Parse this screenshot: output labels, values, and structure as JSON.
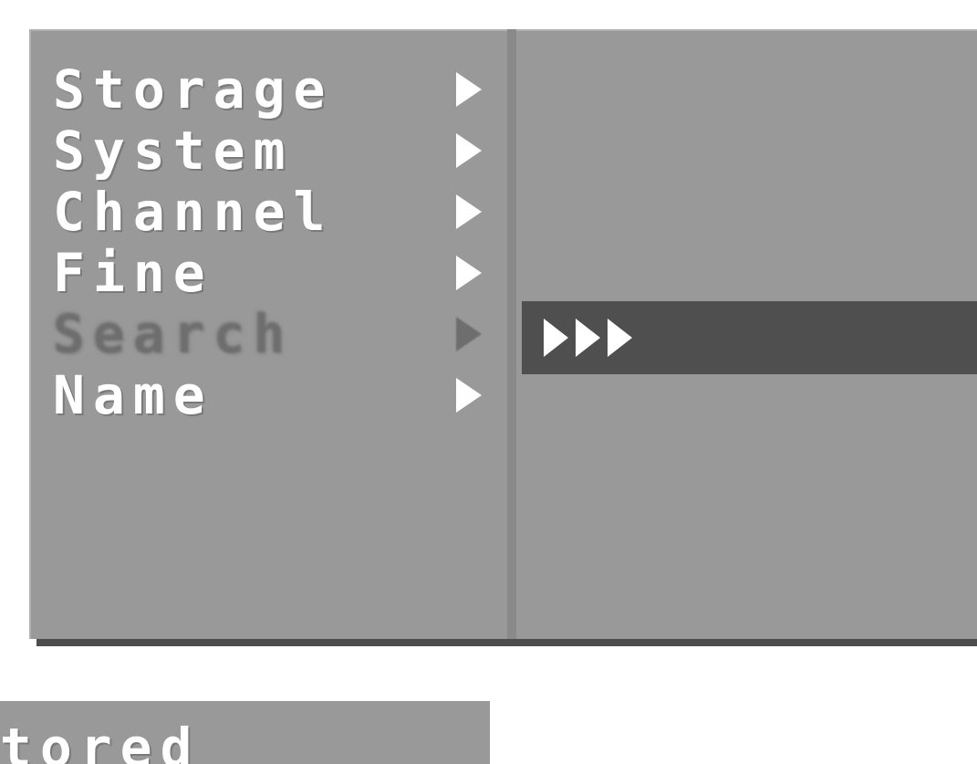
{
  "menu": {
    "items": [
      {
        "label": "Storage",
        "has_submenu": true,
        "disabled": false
      },
      {
        "label": "System",
        "has_submenu": true,
        "disabled": false
      },
      {
        "label": "Channel",
        "has_submenu": true,
        "disabled": false
      },
      {
        "label": "Fine",
        "has_submenu": true,
        "disabled": false
      },
      {
        "label": "Search",
        "has_submenu": true,
        "disabled": true
      },
      {
        "label": "Name",
        "has_submenu": true,
        "disabled": false
      }
    ],
    "submenu": {
      "highlighted_row_icons": [
        "play-arrow-icon",
        "play-arrow-icon",
        "play-arrow-icon"
      ]
    }
  },
  "status_bar": {
    "text": "Stored"
  },
  "colors": {
    "panel_bg": "#999999",
    "divider": "#8a8a8a",
    "highlight_bg": "#4f4f4f",
    "text": "#ffffff",
    "disabled_text": "#6e6e6e",
    "shadow": "#4d4d4d"
  }
}
